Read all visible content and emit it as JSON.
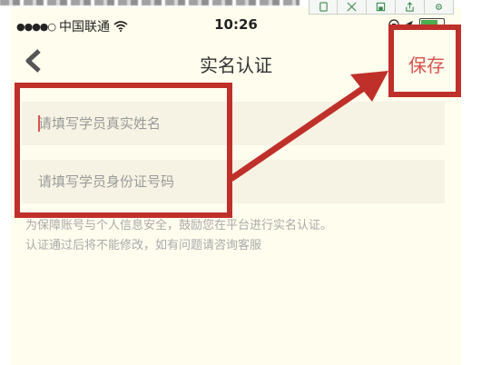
{
  "status_bar": {
    "carrier": "中国联通",
    "time": "10:26"
  },
  "nav": {
    "title": "实名认证",
    "save_label": "保存"
  },
  "form": {
    "name_placeholder": "请填写学员真实姓名",
    "id_placeholder": "请填写学员身份证号码"
  },
  "notice": {
    "line1": "为保障账号与个人信息安全，鼓励您在平台进行实名认证。",
    "line2": "认证通过后将不能修改，如有问题请咨询客服"
  },
  "colors": {
    "annotation_red": "#c0302a",
    "save_text": "#d9534f",
    "screen_bg": "#fffdee"
  }
}
